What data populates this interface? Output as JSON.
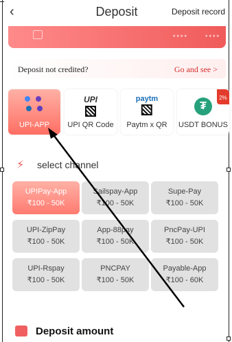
{
  "header": {
    "back_icon": "chevron-left-icon",
    "title": "Deposit",
    "record_label": "Deposit record"
  },
  "card": {
    "masked_1": "****",
    "masked_2": "****"
  },
  "notice": {
    "text": "Deposit not credited?",
    "link": "Go and see >"
  },
  "methods": [
    {
      "label": "UPI-APP",
      "active": true
    },
    {
      "label": "UPI QR Code",
      "active": false
    },
    {
      "label": "Paytm x QR",
      "active": false
    },
    {
      "label": "USDT BONUS",
      "active": false,
      "badge": "2%"
    }
  ],
  "channel_section": {
    "title": "select channel"
  },
  "channels": [
    {
      "name": "UPIPay-App",
      "range": "₹100 - 50K",
      "active": true
    },
    {
      "name": "Sailspay-App",
      "range": "₹100 - 50K",
      "active": false
    },
    {
      "name": "Supe-Pay",
      "range": "₹100 - 50K",
      "active": false
    },
    {
      "name": "UPI-ZipPay",
      "range": "₹100 - 50K",
      "active": false
    },
    {
      "name": "App-88pay",
      "range": "₹100 - 50K",
      "active": false
    },
    {
      "name": "PncPay-UPI",
      "range": "₹100 - 50K",
      "active": false
    },
    {
      "name": "UPI-Rspay",
      "range": "₹100 - 50K",
      "active": false
    },
    {
      "name": "PNCPAY",
      "range": "₹100 - 50K",
      "active": false
    },
    {
      "name": "Payable-App",
      "range": "₹100 - 60K",
      "active": false
    }
  ],
  "amount_section": {
    "title": "Deposit amount"
  },
  "colors": {
    "accent": "#f05b5b",
    "active_gradient_top": "#ffb1a6",
    "active_gradient_bottom": "#ff6e63",
    "channel_bg": "#e1e1e1"
  }
}
